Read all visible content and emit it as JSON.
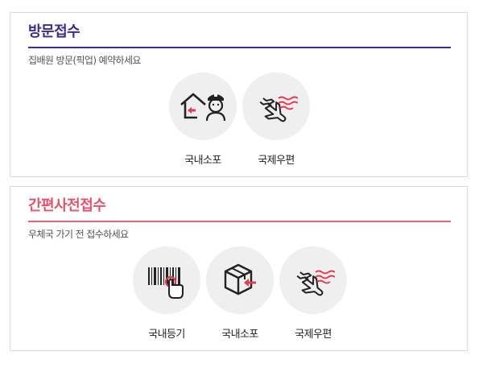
{
  "visit": {
    "title": "방문접수",
    "subtitle": "집배원 방문(픽업) 예약하세요",
    "services": [
      {
        "label": "국내소포",
        "icon": "house-courier-icon"
      },
      {
        "label": "국제우편",
        "icon": "airplane-icon"
      }
    ]
  },
  "quick": {
    "title": "간편사전접수",
    "subtitle": "우체국 가기 전 접수하세요",
    "services": [
      {
        "label": "국내등기",
        "icon": "barcode-tap-icon"
      },
      {
        "label": "국내소포",
        "icon": "parcel-box-icon"
      },
      {
        "label": "국제우편",
        "icon": "airplane-icon"
      }
    ]
  },
  "colors": {
    "visit_accent": "#3c2f86",
    "quick_accent": "#e26478",
    "icon_red": "#e8384f",
    "icon_circle": "#efefef"
  }
}
